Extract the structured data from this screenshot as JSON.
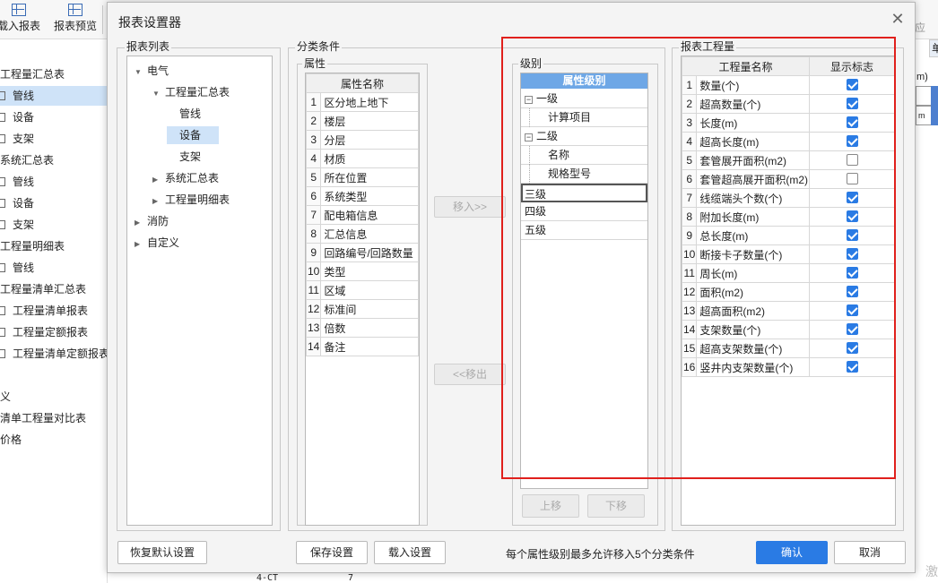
{
  "background": {
    "toolbar": [
      {
        "label": "载入报表"
      },
      {
        "label": "报表预览"
      }
    ],
    "tree_items": [
      {
        "label": "工程量汇总表",
        "indent": 0,
        "icon": false,
        "selected": false
      },
      {
        "label": "管线",
        "indent": 1,
        "icon": true,
        "selected": true
      },
      {
        "label": "设备",
        "indent": 1,
        "icon": true,
        "selected": false
      },
      {
        "label": "支架",
        "indent": 1,
        "icon": true,
        "selected": false
      },
      {
        "label": "系统汇总表",
        "indent": 0,
        "icon": false,
        "selected": false
      },
      {
        "label": "管线",
        "indent": 1,
        "icon": true,
        "selected": false
      },
      {
        "label": "设备",
        "indent": 1,
        "icon": true,
        "selected": false
      },
      {
        "label": "支架",
        "indent": 1,
        "icon": true,
        "selected": false
      },
      {
        "label": "工程量明细表",
        "indent": 0,
        "icon": false,
        "selected": false
      },
      {
        "label": "管线",
        "indent": 1,
        "icon": true,
        "selected": false
      },
      {
        "label": "工程量清单汇总表",
        "indent": 0,
        "icon": false,
        "selected": false
      },
      {
        "label": "工程量清单报表",
        "indent": 1,
        "icon": true,
        "selected": false
      },
      {
        "label": "工程量定额报表",
        "indent": 1,
        "icon": true,
        "selected": false
      },
      {
        "label": "工程量清单定额报表",
        "indent": 1,
        "icon": true,
        "selected": false
      },
      {
        "label": "",
        "indent": 0,
        "icon": false,
        "selected": false
      },
      {
        "label": "义",
        "indent": 0,
        "icon": false,
        "selected": false
      },
      {
        "label": "清单工程量对比表",
        "indent": 0,
        "icon": false,
        "selected": false
      },
      {
        "label": "价格",
        "indent": 0,
        "icon": false,
        "selected": false
      }
    ],
    "right_header": "单",
    "right_text": "m)",
    "right_cell": "m",
    "watermark": "激",
    "corner_text": "应",
    "bottom_cells": [
      "4-CT",
      "7"
    ]
  },
  "dialog": {
    "title": "报表设置器",
    "report_list": {
      "label": "报表列表",
      "tree": [
        {
          "label": "电气",
          "level": 0,
          "arrow": "down",
          "selected": false
        },
        {
          "label": "工程量汇总表",
          "level": 1,
          "arrow": "down",
          "selected": false
        },
        {
          "label": "管线",
          "level": 2,
          "arrow": "",
          "selected": false
        },
        {
          "label": "设备",
          "level": 2,
          "arrow": "",
          "selected": true
        },
        {
          "label": "支架",
          "level": 2,
          "arrow": "",
          "selected": false
        },
        {
          "label": "系统汇总表",
          "level": 1,
          "arrow": "right",
          "selected": false
        },
        {
          "label": "工程量明细表",
          "level": 1,
          "arrow": "right",
          "selected": false
        },
        {
          "label": "消防",
          "level": 0,
          "arrow": "right",
          "selected": false
        },
        {
          "label": "自定义",
          "level": 0,
          "arrow": "right",
          "selected": false
        }
      ]
    },
    "classification": {
      "label": "分类条件",
      "attributes_label": "属性",
      "attributes_header": "属性名称",
      "attributes": [
        "区分地上地下",
        "楼层",
        "分层",
        "材质",
        "所在位置",
        "系统类型",
        "配电箱信息",
        "汇总信息",
        "回路编号/回路数量",
        "类型",
        "区域",
        "标准间",
        "倍数",
        "备注"
      ],
      "move_in": "移入>>",
      "move_out": "<<移出",
      "levels_label": "级别",
      "levels_header": "属性级别",
      "levels": [
        {
          "label": "一级",
          "indent": 0,
          "toggle": "−"
        },
        {
          "label": "计算项目",
          "indent": 1,
          "toggle": ""
        },
        {
          "label": "二级",
          "indent": 0,
          "toggle": "−"
        },
        {
          "label": "名称",
          "indent": 1,
          "toggle": ""
        },
        {
          "label": "规格型号",
          "indent": 1,
          "toggle": ""
        },
        {
          "label": "三级",
          "indent": 0,
          "toggle": "",
          "focus": true
        },
        {
          "label": "四级",
          "indent": 0,
          "toggle": ""
        },
        {
          "label": "五级",
          "indent": 0,
          "toggle": ""
        }
      ],
      "move_up": "上移",
      "move_down": "下移"
    },
    "quantities": {
      "label": "报表工程量",
      "header_name": "工程量名称",
      "header_flag": "显示标志",
      "rows": [
        {
          "name": "数量(个)",
          "checked": true
        },
        {
          "name": "超高数量(个)",
          "checked": true
        },
        {
          "name": "长度(m)",
          "checked": true
        },
        {
          "name": "超高长度(m)",
          "checked": true
        },
        {
          "name": "套管展开面积(m2)",
          "checked": false
        },
        {
          "name": "套管超高展开面积(m2)",
          "checked": false
        },
        {
          "name": "线缆端头个数(个)",
          "checked": true
        },
        {
          "name": "附加长度(m)",
          "checked": true
        },
        {
          "name": "总长度(m)",
          "checked": true
        },
        {
          "name": "断接卡子数量(个)",
          "checked": true
        },
        {
          "name": "周长(m)",
          "checked": true
        },
        {
          "name": "面积(m2)",
          "checked": true
        },
        {
          "name": "超高面积(m2)",
          "checked": true
        },
        {
          "name": "支架数量(个)",
          "checked": true
        },
        {
          "name": "超高支架数量(个)",
          "checked": true
        },
        {
          "name": "竖井内支架数量(个)",
          "checked": true
        }
      ]
    },
    "footer": {
      "restore_default": "恢复默认设置",
      "save_settings": "保存设置",
      "load_settings": "载入设置",
      "hint": "每个属性级别最多允许移入5个分类条件",
      "ok": "确认",
      "cancel": "取消"
    }
  },
  "colors": {
    "accent": "#2a7be4",
    "highlight_box": "#e0201c",
    "level_header": "#6ea7e6",
    "selection": "#cfe3f8"
  }
}
